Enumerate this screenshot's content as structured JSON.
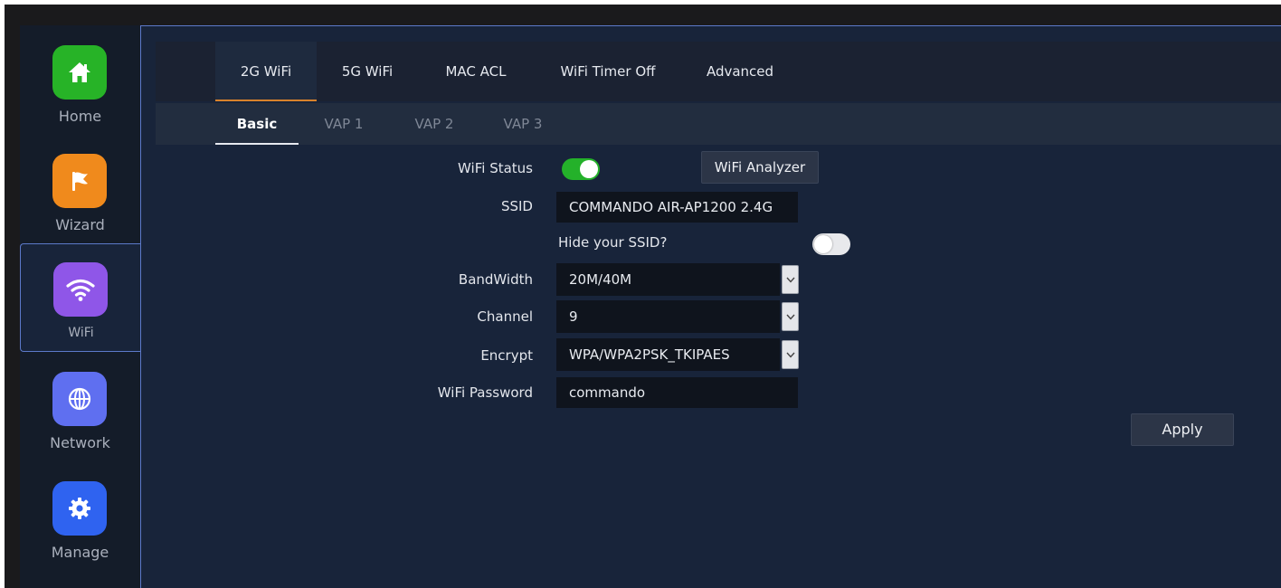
{
  "sidebar": {
    "items": [
      {
        "label": "Home",
        "icon": "home-icon"
      },
      {
        "label": "Wizard",
        "icon": "flag-icon"
      },
      {
        "label": "WiFi",
        "icon": "wifi-icon"
      },
      {
        "label": "Network",
        "icon": "globe-icon"
      },
      {
        "label": "Manage",
        "icon": "gear-icon"
      }
    ],
    "active": "WiFi"
  },
  "tabs": [
    "2G WiFi",
    "5G WiFi",
    "MAC ACL",
    "WiFi Timer Off",
    "Advanced"
  ],
  "active_tab": "2G WiFi",
  "subtabs": [
    "Basic",
    "VAP 1",
    "VAP 2",
    "VAP 3"
  ],
  "active_subtab": "Basic",
  "form": {
    "wifi_status_label": "WiFi Status",
    "wifi_status_on": true,
    "wifi_analyzer_label": "WiFi Analyzer",
    "ssid_label": "SSID",
    "ssid_value": "COMMANDO AIR-AP1200 2.4G",
    "hide_ssid_label": "Hide your SSID?",
    "hide_ssid_on": false,
    "bandwidth_label": "BandWidth",
    "bandwidth_value": "20M/40M",
    "channel_label": "Channel",
    "channel_value": "9",
    "encrypt_label": "Encrypt",
    "encrypt_value": "WPA/WPA2PSK_TKIPAES",
    "password_label": "WiFi Password",
    "password_value": "commando",
    "apply_label": "Apply"
  },
  "colors": {
    "home_icon": "#27b327",
    "wizard_icon": "#f08a1c",
    "wifi_icon": "#8f56e8",
    "network_icon": "#5f6ff0",
    "manage_icon": "#2f63f0",
    "toggle_on": "#24b12a",
    "tab_active_underline": "#d9822b"
  }
}
